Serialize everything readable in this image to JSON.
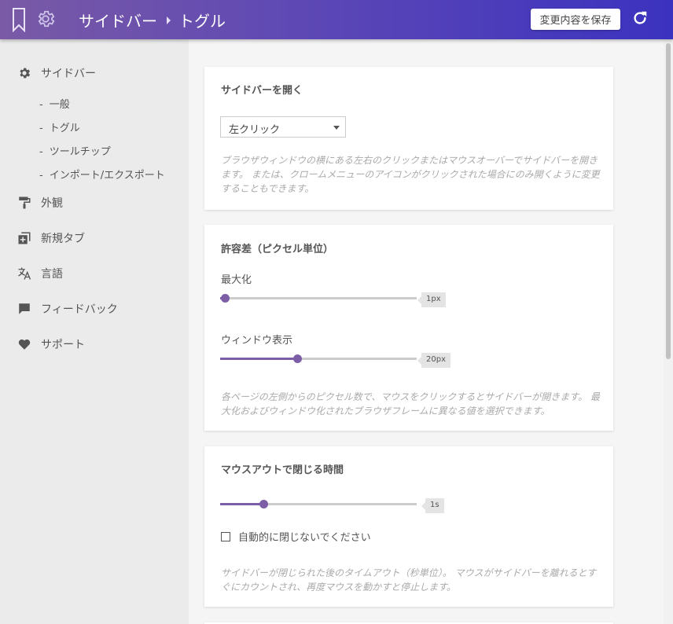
{
  "header": {
    "breadcrumb_root": "サイドバー",
    "breadcrumb_current": "トグル",
    "save_label": "変更内容を保存"
  },
  "sidebar": {
    "items": [
      {
        "label": "サイドバー",
        "icon": "gear-icon"
      },
      {
        "label": "外観",
        "icon": "paint-roller-icon"
      },
      {
        "label": "新規タブ",
        "icon": "new-tab-icon"
      },
      {
        "label": "言語",
        "icon": "translate-icon"
      },
      {
        "label": "フィードバック",
        "icon": "chat-icon"
      },
      {
        "label": "サポート",
        "icon": "heart-icon"
      }
    ],
    "subitems": [
      {
        "label": "一般"
      },
      {
        "label": "トグル"
      },
      {
        "label": "ツールチップ"
      },
      {
        "label": "インポート/エクスポート"
      }
    ]
  },
  "cards": {
    "open": {
      "title": "サイドバーを開く",
      "select_value": "左クリック",
      "description": "ブラウザウィンドウの横にある左右のクリックまたはマウスオーバーでサイドバーを開きます。 または、クロームメニューのアイコンがクリックされた場合にのみ開くように変更することもできます。"
    },
    "tolerance": {
      "title": "許容差（ピクセル単位）",
      "maximized_label": "最大化",
      "maximized_value": "1px",
      "maximized_fraction": 0.0,
      "windowed_label": "ウィンドウ表示",
      "windowed_value": "20px",
      "windowed_fraction": 0.39,
      "description": "各ページの左側からのピクセル数で、マウスをクリックするとサイドバーが開きます。 最大化およびウィンドウ化されたブラウザフレームに異なる値を選択できます。"
    },
    "mouseout": {
      "title": "マウスアウトで閉じる時間",
      "value": "1s",
      "fraction": 0.22,
      "checkbox_label": "自動的に閉じないでください",
      "checkbox_checked": false,
      "description": "サイドバーが閉じられた後のタイムアウト（秒単位）。 マウスがサイドバーを離れるとすぐにカウントされ、再度マウスを動かすと停止します。"
    }
  },
  "colors": {
    "accent": "#7b5ea5",
    "header_start": "#7a5aa6",
    "header_end": "#3b32bf"
  }
}
